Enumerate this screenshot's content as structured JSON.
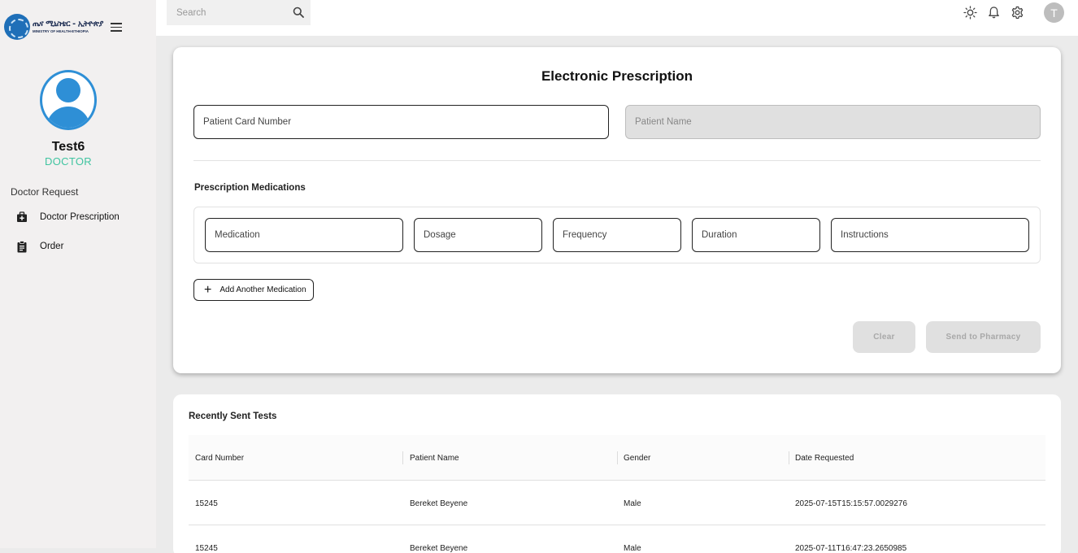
{
  "brand": {
    "name_amharic": "ጤና ሚኒስቴር - ኢትዮጵያ",
    "name_english": "MINISTRY OF HEALTH-ETHIOPIA"
  },
  "user": {
    "name": "Test6",
    "role": "DOCTOR",
    "avatar_initial": "T"
  },
  "sidebar": {
    "section_label": "Doctor Request",
    "items": [
      {
        "label": "Doctor Prescription",
        "icon": "medical-bag-icon"
      },
      {
        "label": "Order",
        "icon": "clipboard-icon"
      }
    ]
  },
  "topbar": {
    "search_placeholder": "Search",
    "icons": [
      "sun-icon",
      "bell-icon",
      "gear-icon"
    ]
  },
  "prescription": {
    "title": "Electronic Prescription",
    "patient_card_placeholder": "Patient Card Number",
    "patient_name_placeholder": "Patient Name",
    "medications_title": "Prescription Medications",
    "med_fields": {
      "medication": "Medication",
      "dosage": "Dosage",
      "frequency": "Frequency",
      "duration": "Duration",
      "instructions": "Instructions"
    },
    "add_label": "Add Another Medication",
    "clear_label": "Clear",
    "send_label": "Send to Pharmacy"
  },
  "recent": {
    "title": "Recently Sent Tests",
    "columns": [
      "Card Number",
      "Patient Name",
      "Gender",
      "Date Requested"
    ],
    "rows": [
      {
        "card": "15245",
        "name": "Bereket Beyene",
        "gender": "Male",
        "date": "2025-07-15T15:15:57.0029276"
      },
      {
        "card": "15245",
        "name": "Bereket Beyene",
        "gender": "Male",
        "date": "2025-07-11T16:47:23.2650985"
      }
    ]
  },
  "colors": {
    "accent_blue": "#2e8fd6",
    "role_green": "#40c4a0",
    "disabled_button": "#e0e0e0"
  }
}
